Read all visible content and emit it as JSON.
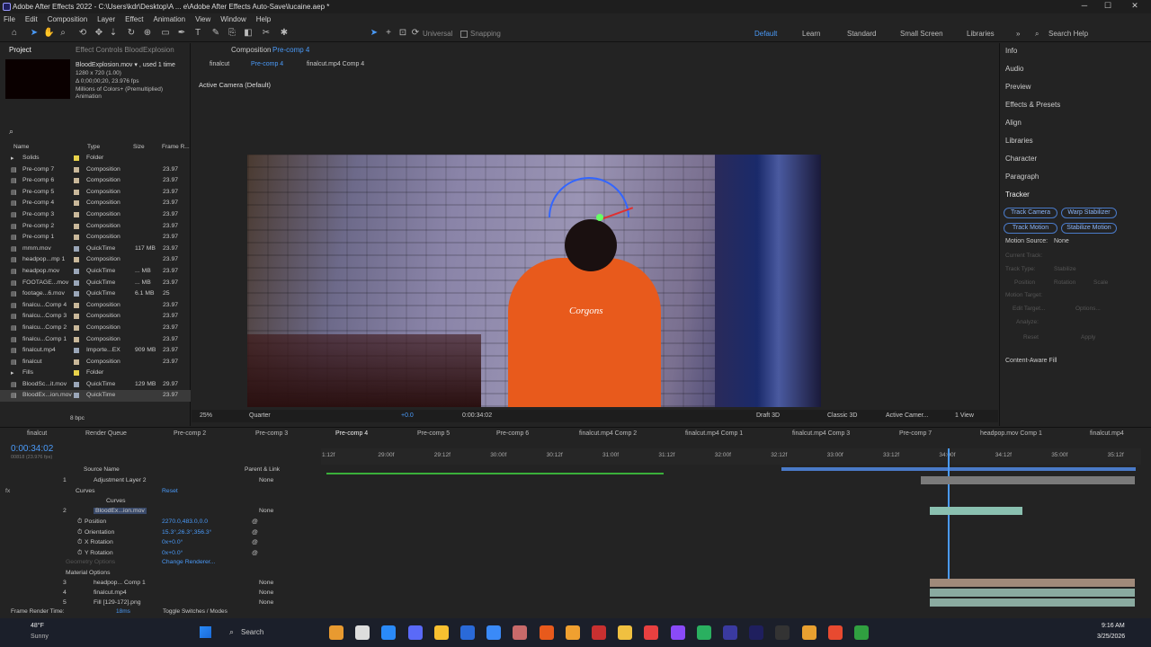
{
  "window": {
    "title": "Adobe After Effects 2022 - C:\\Users\\kdr\\Desktop\\A ... e\\Adobe After Effects Auto-Save\\lucaine.aep *",
    "min": "─",
    "max": "☐",
    "close": "✕"
  },
  "menu": [
    "File",
    "Edit",
    "Composition",
    "Layer",
    "Effect",
    "Animation",
    "View",
    "Window",
    "Help"
  ],
  "toolbar": {
    "universal": "Universal",
    "snapping": "Snapping",
    "workspaces": [
      "Default",
      "Learn",
      "Standard",
      "Small Screen",
      "Libraries"
    ],
    "search": "Search Help"
  },
  "project": {
    "tab_project": "Project",
    "tab_effects": "Effect Controls BloodExplosion",
    "file": {
      "name": "BloodExplosion.mov ▾ , used 1 time",
      "res": "1280 x 720 (1.00)",
      "dur": "Δ 0;00;00;20, 23.976 fps",
      "colors": "Millions of Colors+ (Premultiplied)",
      "codec": "Animation"
    },
    "headers": {
      "name": "Name",
      "type": "Type",
      "size": "Size",
      "rate": "Frame R..."
    },
    "items": [
      {
        "name": "Solids",
        "type": "Folder",
        "size": "",
        "rate": "",
        "color": "#e8d24a"
      },
      {
        "name": "Pre-comp 7",
        "type": "Composition",
        "size": "",
        "rate": "23.97",
        "color": "#c9b89a"
      },
      {
        "name": "Pre-comp 6",
        "type": "Composition",
        "size": "",
        "rate": "23.97",
        "color": "#c9b89a"
      },
      {
        "name": "Pre-comp 5",
        "type": "Composition",
        "size": "",
        "rate": "23.97",
        "color": "#c9b89a"
      },
      {
        "name": "Pre-comp 4",
        "type": "Composition",
        "size": "",
        "rate": "23.97",
        "color": "#c9b89a"
      },
      {
        "name": "Pre-comp 3",
        "type": "Composition",
        "size": "",
        "rate": "23.97",
        "color": "#c9b89a"
      },
      {
        "name": "Pre-comp 2",
        "type": "Composition",
        "size": "",
        "rate": "23.97",
        "color": "#c9b89a"
      },
      {
        "name": "Pre-comp 1",
        "type": "Composition",
        "size": "",
        "rate": "23.97",
        "color": "#c9b89a"
      },
      {
        "name": "mmm.mov",
        "type": "QuickTime",
        "size": "117 MB",
        "rate": "23.97",
        "color": "#9aa6b8"
      },
      {
        "name": "headpop...mp 1",
        "type": "Composition",
        "size": "",
        "rate": "23.97",
        "color": "#c9b89a"
      },
      {
        "name": "headpop.mov",
        "type": "QuickTime",
        "size": "... MB",
        "rate": "23.97",
        "color": "#9aa6b8"
      },
      {
        "name": "FOOTAGE...mov",
        "type": "QuickTime",
        "size": "... MB",
        "rate": "23.97",
        "color": "#9aa6b8"
      },
      {
        "name": "footage...6.mov",
        "type": "QuickTime",
        "size": "6.1 MB",
        "rate": "25",
        "color": "#9aa6b8"
      },
      {
        "name": "finalcu...Comp 4",
        "type": "Composition",
        "size": "",
        "rate": "23.97",
        "color": "#c9b89a"
      },
      {
        "name": "finalcu...Comp 3",
        "type": "Composition",
        "size": "",
        "rate": "23.97",
        "color": "#c9b89a"
      },
      {
        "name": "finalcu...Comp 2",
        "type": "Composition",
        "size": "",
        "rate": "23.97",
        "color": "#c9b89a"
      },
      {
        "name": "finalcu...Comp 1",
        "type": "Composition",
        "size": "",
        "rate": "23.97",
        "color": "#c9b89a"
      },
      {
        "name": "finalcut.mp4",
        "type": "Importe...EX",
        "size": "909 MB",
        "rate": "23.97",
        "color": "#9aa6b8"
      },
      {
        "name": "finalcut",
        "type": "Composition",
        "size": "",
        "rate": "23.97",
        "color": "#c9b89a"
      },
      {
        "name": "Fills",
        "type": "Folder",
        "size": "",
        "rate": "",
        "color": "#e8d24a"
      },
      {
        "name": "BloodSc...it.mov",
        "type": "QuickTime",
        "size": "129 MB",
        "rate": "29.97",
        "color": "#9aa6b8"
      },
      {
        "name": "BloodEx...ion.mov",
        "type": "QuickTime",
        "size": "",
        "rate": "23.97",
        "color": "#9aa6b8"
      }
    ],
    "bpc": "8 bpc"
  },
  "comp": {
    "tab": "Composition",
    "tab_name": "Pre-comp 4",
    "crumbs": [
      "finalcut",
      "Pre-comp 4",
      "finalcut.mp4 Comp 4"
    ],
    "camera_label": "Active Camera (Default)",
    "logo": "Corgons"
  },
  "viewbar": {
    "zoom": "25%",
    "res": "Quarter",
    "exposure": "+0.0",
    "time": "0:00:34:02",
    "draft": "Draft 3D",
    "renderer": "Classic 3D",
    "camera": "Active Camer...",
    "views": "1 View"
  },
  "right": {
    "items": [
      "Info",
      "Audio",
      "Preview",
      "Effects & Presets",
      "Align",
      "Libraries",
      "Character",
      "Paragraph"
    ],
    "tracker": {
      "title": "Tracker",
      "buttons": [
        "Track Camera",
        "Warp Stabilizer",
        "Track Motion",
        "Stabilize Motion"
      ],
      "motion_source_label": "Motion Source:",
      "motion_source": "None",
      "current_track": "Current Track:",
      "track_type": "Track Type:",
      "track_type_val": "Stabilize",
      "position": "Position",
      "rotation": "Rotation",
      "scale": "Scale",
      "motion_target": "Motion Target:",
      "edit_target": "Edit Target...",
      "options": "Options...",
      "analyze": "Analyze:",
      "reset": "Reset",
      "apply": "Apply"
    },
    "caf": "Content-Aware Fill"
  },
  "timeline": {
    "tabs": [
      "finalcut",
      "Render Queue",
      "Pre-comp 2",
      "Pre-comp 3",
      "Pre-comp 4",
      "Pre-comp 5",
      "Pre-comp 6",
      "finalcut.mp4 Comp 2",
      "finalcut.mp4 Comp 1",
      "finalcut.mp4 Comp 3",
      "Pre-comp 7",
      "headpop.mov Comp 1",
      "finalcut.mp4"
    ],
    "timecode": "0:00:34:02",
    "frames": "00818 (23.976 fps)",
    "col_source": "Source Name",
    "col_parent": "Parent & Link",
    "layers": [
      {
        "num": "1",
        "name": "Adjustment Layer 2",
        "parent": "None",
        "color": "#9aa6b8"
      },
      {
        "num": "",
        "name": "Curves",
        "parent": "",
        "color": ""
      },
      {
        "num": "2",
        "name": "BloodEx...ion.mov",
        "parent": "None",
        "color": "#9aa6b8"
      },
      {
        "num": "3",
        "name": "headpop... Comp 1",
        "parent": "None",
        "color": "#c9b89a"
      },
      {
        "num": "4",
        "name": "finalcut.mp4",
        "parent": "None",
        "color": "#9aa6b8"
      },
      {
        "num": "5",
        "name": "Fill [129-172].png",
        "parent": "None",
        "color": "#9aa6b8"
      }
    ],
    "effects_label": "Effects",
    "curves_label": "Curves",
    "reset": "Reset",
    "props": [
      {
        "name": "Position",
        "val": "2270.0,483.0,0.0"
      },
      {
        "name": "Orientation",
        "val": "15.3°,26.3°,356.3°"
      },
      {
        "name": "X Rotation",
        "val": "0x+0.0°"
      },
      {
        "name": "Y Rotation",
        "val": "0x+0.0°"
      }
    ],
    "geometry": "Geometry Options",
    "change_renderer": "Change Renderer...",
    "material": "Material Options",
    "ruler": [
      "1:12f",
      "29:00f",
      "29:12f",
      "30:00f",
      "30:12f",
      "31:00f",
      "31:12f",
      "32:00f",
      "32:12f",
      "33:00f",
      "33:12f",
      "34:00f",
      "34:12f",
      "35:00f",
      "35:12f"
    ],
    "footer_left": "Frame Render Time:",
    "footer_ms": "18ms",
    "footer_toggle": "Toggle Switches / Modes"
  },
  "taskbar": {
    "weather_temp": "48°F",
    "weather_desc": "Sunny",
    "search": "Search",
    "time": "9:16 AM",
    "date": "3/25/2026"
  }
}
